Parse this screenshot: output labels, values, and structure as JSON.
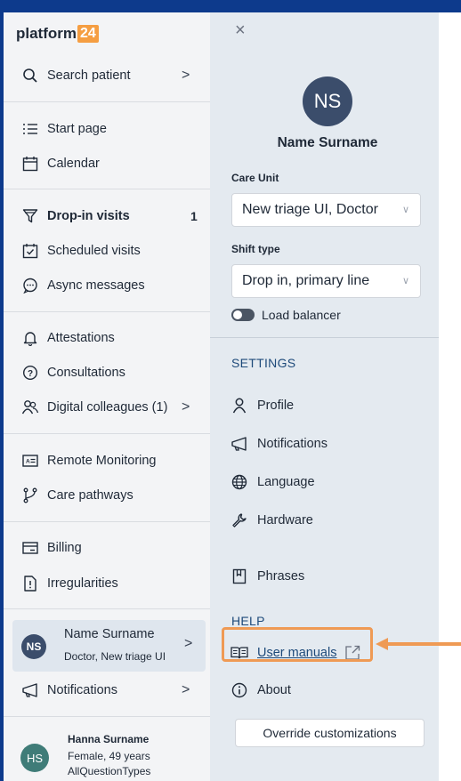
{
  "app": {
    "logo_text": "platform",
    "logo_badge": "24"
  },
  "sidebar": {
    "search": {
      "label": "Search patient",
      "chevron": ">"
    },
    "items": [
      {
        "label": "Start page",
        "icon": "list-icon"
      },
      {
        "label": "Calendar",
        "icon": "calendar-icon"
      },
      {
        "label": "Drop-in visits",
        "icon": "funnel-icon",
        "count": "1"
      },
      {
        "label": "Scheduled visits",
        "icon": "calendar-check-icon"
      },
      {
        "label": "Async messages",
        "icon": "chat-icon"
      },
      {
        "label": "Attestations",
        "icon": "bell-icon"
      },
      {
        "label": "Consultations",
        "icon": "question-icon"
      },
      {
        "label": "Digital colleagues (1)",
        "icon": "people-icon",
        "chevron": ">"
      },
      {
        "label": "Remote Monitoring",
        "icon": "id-card-icon"
      },
      {
        "label": "Care pathways",
        "icon": "branch-icon"
      },
      {
        "label": "Billing",
        "icon": "card-icon"
      },
      {
        "label": "Irregularities",
        "icon": "warning-file-icon"
      }
    ],
    "user": {
      "initials": "NS",
      "name": "Name Surname",
      "role": "Doctor, New triage UI",
      "chevron": ">"
    },
    "notifications": {
      "label": "Notifications",
      "chevron": ">"
    },
    "patient": {
      "initials": "HS",
      "name": "Hanna Surname",
      "line1": "Female, 49 years",
      "line2": "AllQuestionTypes"
    }
  },
  "panel": {
    "close": "×",
    "initials": "NS",
    "name": "Name Surname",
    "care_unit": {
      "label": "Care Unit",
      "value": "New triage UI, Doctor"
    },
    "shift_type": {
      "label": "Shift type",
      "value": "Drop in, primary line"
    },
    "load_balancer": {
      "label": "Load balancer",
      "enabled": false
    },
    "settings": {
      "title": "SETTINGS",
      "items": [
        {
          "label": "Profile",
          "icon": "person-icon"
        },
        {
          "label": "Notifications",
          "icon": "megaphone-icon"
        },
        {
          "label": "Language",
          "icon": "globe-icon"
        },
        {
          "label": "Hardware",
          "icon": "wrench-icon"
        },
        {
          "label": "Phrases",
          "icon": "bookmark-icon"
        }
      ]
    },
    "help": {
      "title": "HELP",
      "user_manuals": "User manuals",
      "about": "About"
    },
    "override_button": "Override customizations"
  },
  "colors": {
    "accent": "#1e4a7a",
    "highlight": "#ef9a54",
    "panel_bg": "#e4eaf0",
    "frame_border": "#0d3a8c"
  }
}
